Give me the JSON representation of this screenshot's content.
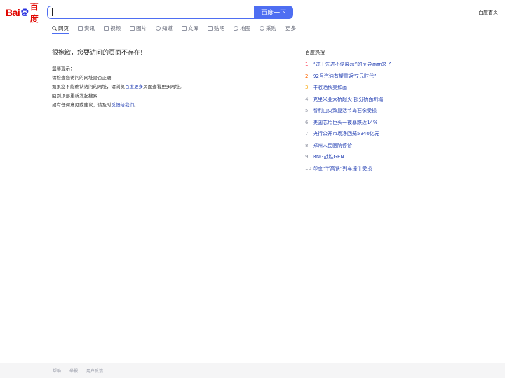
{
  "header": {
    "logo_text": "Bai",
    "logo_du": "百度",
    "search_value": "",
    "search_button": "百度一下",
    "home_link": "百度首页"
  },
  "tabs": [
    {
      "label": "网页",
      "active": true
    },
    {
      "label": "资讯"
    },
    {
      "label": "视频"
    },
    {
      "label": "图片"
    },
    {
      "label": "知道"
    },
    {
      "label": "文库"
    },
    {
      "label": "贴吧"
    },
    {
      "label": "地图"
    },
    {
      "label": "采购"
    },
    {
      "label": "更多"
    }
  ],
  "error": {
    "title": "很抱歉，您要访问的页面不存在!",
    "tips_heading": "温馨提示：",
    "tip1": "请检查您访问的网址是否正确",
    "tip2_prefix": "如果您不能确认访问的网址，请浏览",
    "tip2_link": "百度更多",
    "tip2_suffix": "页面查看更多网址。",
    "tip3": "回到顶部重新发起搜索",
    "tip4_prefix": "如有任何意见或建议，请及时",
    "tip4_link": "反馈给我们",
    "tip4_suffix": "。"
  },
  "hot": {
    "title": "百度热搜",
    "items": [
      {
        "rank": "1",
        "text": "“过于先进不便展示”的反导画面来了"
      },
      {
        "rank": "2",
        "text": "92号汽油有望重返“7元时代”"
      },
      {
        "rank": "3",
        "text": "丰收晒秋美如画"
      },
      {
        "rank": "4",
        "text": "克里米亚大桥起火 部分桥面坍塌"
      },
      {
        "rank": "5",
        "text": "智利山火致复活节岛石像受损"
      },
      {
        "rank": "6",
        "text": "美国芯片巨头一夜暴跌近14%"
      },
      {
        "rank": "7",
        "text": "央行公开市场净回笼5940亿元"
      },
      {
        "rank": "8",
        "text": "郑州人民医院停诊"
      },
      {
        "rank": "9",
        "text": "RNG战胜GEN"
      },
      {
        "rank": "10",
        "text": "印度“半高铁”列车撞牛受损"
      }
    ]
  },
  "footer": {
    "help": "帮助",
    "report": "举报",
    "feedback": "用户反馈"
  },
  "colors": {
    "accent": "#4e6ef2",
    "logo": "#e10601",
    "link": "#2440b3"
  }
}
